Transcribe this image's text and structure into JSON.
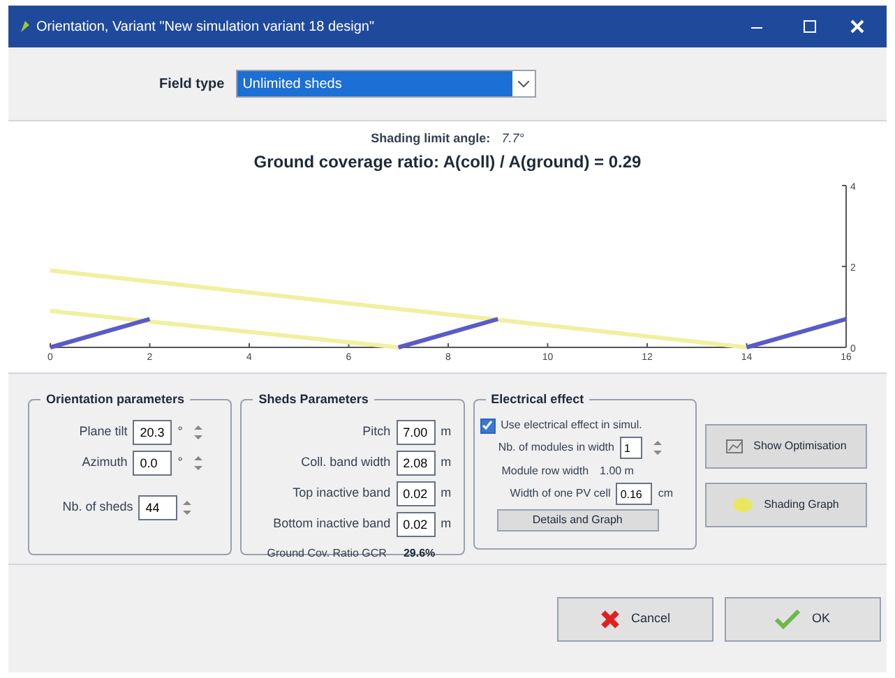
{
  "window": {
    "title": "Orientation, Variant \"New simulation variant 18 design\""
  },
  "field_type": {
    "label": "Field type",
    "value": "Unlimited sheds"
  },
  "chart": {
    "subtitle": "Shading limit angle:",
    "angle": "7.7°",
    "title": "Ground coverage ratio: A(coll) / A(ground) = 0.29",
    "chart_data": {
      "type": "line",
      "x": [
        0,
        2,
        7,
        9,
        14,
        16
      ],
      "xlim": [
        0,
        16
      ],
      "ylim": [
        0,
        4
      ],
      "xticks": [
        0,
        2,
        4,
        6,
        8,
        10,
        12,
        14,
        16
      ],
      "yticks": [
        0,
        2,
        4
      ],
      "series": [
        {
          "color": "#f0f0a0",
          "values": [
            1.9,
            1.63,
            0.95,
            0.68,
            0,
            null
          ]
        },
        {
          "color": "#f0f0a0",
          "values": [
            0.9,
            0.64,
            0,
            null,
            null,
            null
          ]
        },
        {
          "color": "#5a5ac8",
          "values": [
            0,
            0.7,
            null,
            null,
            null,
            null
          ]
        },
        {
          "color": "#5a5ac8",
          "values": [
            null,
            null,
            0,
            0.7,
            null,
            null
          ]
        },
        {
          "color": "#5a5ac8",
          "values": [
            null,
            null,
            null,
            null,
            0,
            0.7
          ]
        }
      ]
    }
  },
  "orientation": {
    "title": "Orientation parameters",
    "fields": [
      {
        "label": "Plane tilt",
        "value": "20.3",
        "unit": "°"
      },
      {
        "label": "Azimuth",
        "value": "0.0",
        "unit": "°"
      },
      {
        "label": "Nb. of sheds",
        "value": "44"
      }
    ]
  },
  "sheds": {
    "title": "Sheds Parameters",
    "fields": [
      {
        "label": "Pitch",
        "value": "7.00",
        "unit": "m"
      },
      {
        "label": "Coll. band width",
        "value": "2.08",
        "unit": "m"
      },
      {
        "label": "Top inactive band",
        "value": "0.02",
        "unit": "m"
      },
      {
        "label": "Bottom inactive band",
        "value": "0.02",
        "unit": "m"
      }
    ],
    "gcr_label": "Ground Cov. Ratio GCR",
    "gcr_value": "29.6%"
  },
  "electrical": {
    "title": "Electrical effect",
    "checkbox": {
      "label": "Use electrical effect in simul.",
      "checked": true
    },
    "modules_label": "Nb. of modules in width",
    "modules_value": "1",
    "row_label": "Module row width",
    "row_value": "1.00 m",
    "cell_label": "Width of one PV cell",
    "cell_value": "0.16",
    "cell_unit": "cm",
    "details_button": "Details and Graph"
  },
  "side_buttons": [
    "Show Optimisation",
    "Shading Graph"
  ],
  "buttons": [
    "Cancel",
    "OK"
  ]
}
